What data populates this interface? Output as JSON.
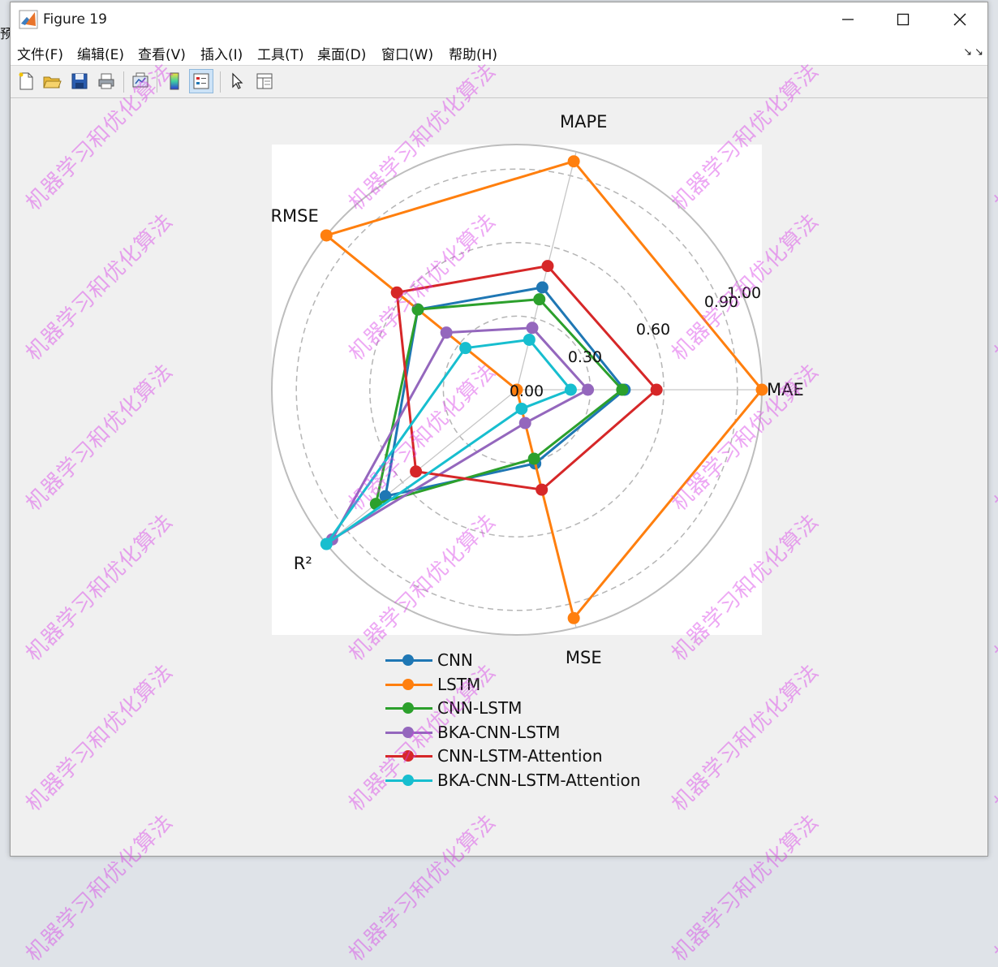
{
  "window": {
    "title": "Figure 19",
    "left_edge_stub": "预"
  },
  "menu": {
    "items": [
      "文件(F)",
      "编辑(E)",
      "查看(V)",
      "插入(I)",
      "工具(T)",
      "桌面(D)",
      "窗口(W)",
      "帮助(H)"
    ],
    "overflow_arrows": "↘↘"
  },
  "toolbar": {
    "icons": [
      "new-figure-icon",
      "open-file-icon",
      "save-icon",
      "print-icon",
      "link-plot-icon",
      "insert-colorbar-icon",
      "insert-legend-icon",
      "select-pointer-icon",
      "property-inspector-icon"
    ]
  },
  "watermark_text": "机器学习和优化算法",
  "chart_data": {
    "type": "radar",
    "axes": [
      "MAE",
      "MAPE",
      "RMSE",
      "R²",
      "MSE"
    ],
    "radial_ticks": [
      "0.00",
      "0.30",
      "0.60",
      "0.90",
      "1.00"
    ],
    "radial_tick_values": [
      0.0,
      0.3,
      0.6,
      0.9,
      1.0
    ],
    "rlim": [
      0,
      1.0
    ],
    "grid": true,
    "legend_position": "bottom",
    "series": [
      {
        "name": "CNN",
        "color": "#1f77b4",
        "values": [
          0.44,
          0.43,
          0.52,
          0.69,
          0.31
        ]
      },
      {
        "name": "LSTM",
        "color": "#ff7f0e",
        "values": [
          1.0,
          0.96,
          1.0,
          0.0,
          0.96
        ]
      },
      {
        "name": "CNN-LSTM",
        "color": "#2ca02c",
        "values": [
          0.43,
          0.38,
          0.52,
          0.74,
          0.29
        ]
      },
      {
        "name": "BKA-CNN-LSTM",
        "color": "#9467bd",
        "values": [
          0.29,
          0.26,
          0.37,
          0.97,
          0.14
        ]
      },
      {
        "name": "CNN-LSTM-Attention",
        "color": "#d62728",
        "values": [
          0.57,
          0.52,
          0.63,
          0.53,
          0.42
        ]
      },
      {
        "name": "BKA-CNN-LSTM-Attention",
        "color": "#17becf",
        "values": [
          0.22,
          0.21,
          0.27,
          1.0,
          0.08
        ]
      }
    ]
  }
}
